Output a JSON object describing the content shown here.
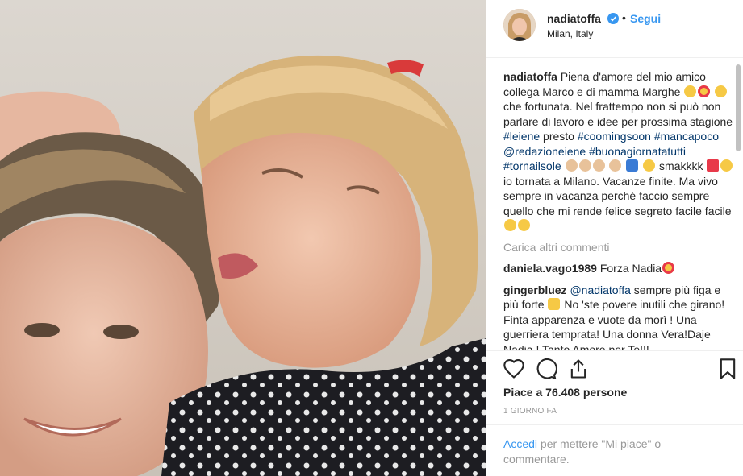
{
  "post": {
    "username": "nadiatoffa",
    "follow_label": "Segui",
    "separator": "•",
    "location": "Milan, Italy",
    "caption": {
      "author": "nadiatoffa",
      "part1": " Piena d'amore del mio amico collega Marco e di mamma Marghe ",
      "part2": " che fortunata. Nel frattempo non si può non parlare di lavoro e idee per prossima stagione ",
      "tag_leiene": "#leiene",
      "part3": " presto ",
      "tag_coming": "#coomingsoon",
      "tag_manca": "#mancapoco",
      "tag_redazione": "@redazioneiene",
      "tag_buona": "#buonagiornatatutti",
      "tag_torna": "#tornailsole",
      "part4": " smakkkk ",
      "part5": " io tornata a Milano. Vacanze finite. Ma vivo sempre in vacanza perché faccio sempre quello che mi rende felice segreto facile facile "
    },
    "load_more": "Carica altri commenti",
    "comments": [
      {
        "user": "daniela.vago1989",
        "text": " Forza Nadia"
      },
      {
        "user": "gingerbluez",
        "mention": "@nadiatoffa",
        "text1": " sempre più figa e più forte ",
        "text2": " No 'ste povere inutili che girano! Finta apparenza e vuote da morì ! Una guerriera temprata! Una donna Vera!Daje Nadia ! Tanto Amore per Te!!!"
      }
    ],
    "likes": "Piace a 76.408 persone",
    "time": "1 GIORNO FA",
    "footer": {
      "login": "Accedi",
      "rest": " per mettere \"Mi piace\" o commentare."
    }
  },
  "icons": [
    "verified-badge-icon",
    "heart-icon",
    "comment-icon",
    "share-icon",
    "bookmark-icon"
  ],
  "colors": {
    "link": "#3897f0",
    "hashtag": "#003569",
    "muted": "#999999",
    "text": "#262626",
    "border": "#efefef"
  }
}
